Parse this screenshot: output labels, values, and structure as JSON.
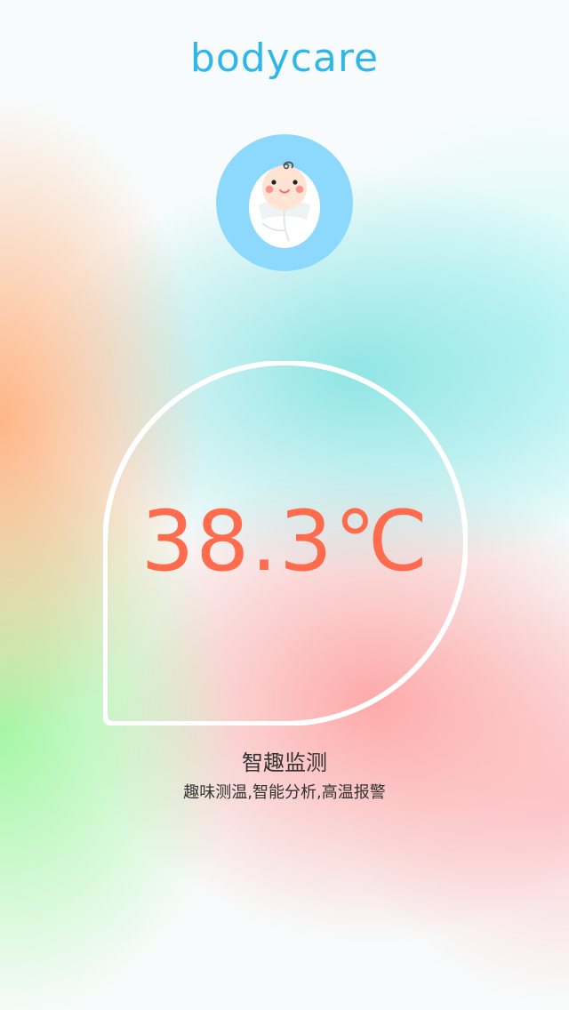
{
  "header": {
    "logo_text": "bodycare"
  },
  "avatar": {
    "icon": "baby-icon",
    "ring_color": "#8dd9fd"
  },
  "temperature": {
    "value": "38.3℃",
    "color": "#ff6b4d"
  },
  "feature": {
    "title": "智趣监测",
    "description": "趣味测温,智能分析,高温报警"
  },
  "colors": {
    "brand": "#2fb7ec",
    "text": "#333333"
  }
}
